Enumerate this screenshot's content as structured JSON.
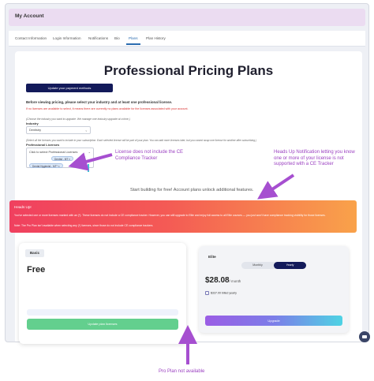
{
  "header": {
    "title": "My Account"
  },
  "tabs": [
    "Contact Information",
    "Login Information",
    "Notifications",
    "Bio",
    "Plans",
    "Plan History"
  ],
  "active_tab": "Plans",
  "page": {
    "title": "Professional Pricing Plans",
    "update_payment_label": "Update your payment methods",
    "intro": "Before viewing pricing, please select your industry and at least one professional license.",
    "warning": "If no licenses are available to select, it means there are currently no plans available for the licenses associated with your account.",
    "industry_hint": "(Choose the industry you want to upgrade. We manage one industry upgrade at a time.)",
    "industry_label": "Industry",
    "industry_value": "Dentistry",
    "licenses_hint": "(Select all the licenses you want to include in your subscription. Each selected license will be part of your plan. You can add more licenses later, but you cannot swap one license for another after subscribing.)",
    "licenses_label": "Professional Licenses",
    "licenses_placeholder": "Click to select Professional Licenses",
    "license_chips": [
      "Dentist - MT ×",
      "Dental Hygienist - MT* ×"
    ],
    "start_building": "Start building for free! Account plans unlock additional features."
  },
  "banner": {
    "heading": "Heads Up!",
    "body": "You've selected one or more licenses marked with an (*). These licenses do not include a CE compliance tracker. However, you can still upgrade to Elite and enjoy full access to all Elite courses — you just won't have compliance tracking visibility for those licenses.",
    "note": "Note: The Pro Plan isn't available when selecting any (*) licenses, since those do not include CE compliance trackers."
  },
  "plans": {
    "basic": {
      "name": "Basic",
      "price": "Free",
      "button": "Update plan licenses"
    },
    "elite": {
      "name": "Elite",
      "toggle": [
        "Monthly",
        "Yearly"
      ],
      "selected_toggle": "Yearly",
      "price": "$28.08",
      "period": "/ month",
      "billed": "$337.00 billed yearly",
      "button": "Upgrade"
    }
  },
  "annotations": {
    "no_tracker": "License does not include the CE Compliance Tracker",
    "heads_up": "Heads Up Notification letting you know one or more of your license is not supported with a CE Tracker",
    "pro_plan": "Pro Plan not available"
  },
  "colors": {
    "accent_navy": "#131a5a",
    "annotation_purple": "#9a3fc0",
    "banner_start": "#f0405f",
    "banner_end": "#f9a24a",
    "basic_button": "#63cf8e"
  },
  "icons": [
    "chevron-down-icon",
    "calendar-icon",
    "chat-icon",
    "close-icon"
  ]
}
